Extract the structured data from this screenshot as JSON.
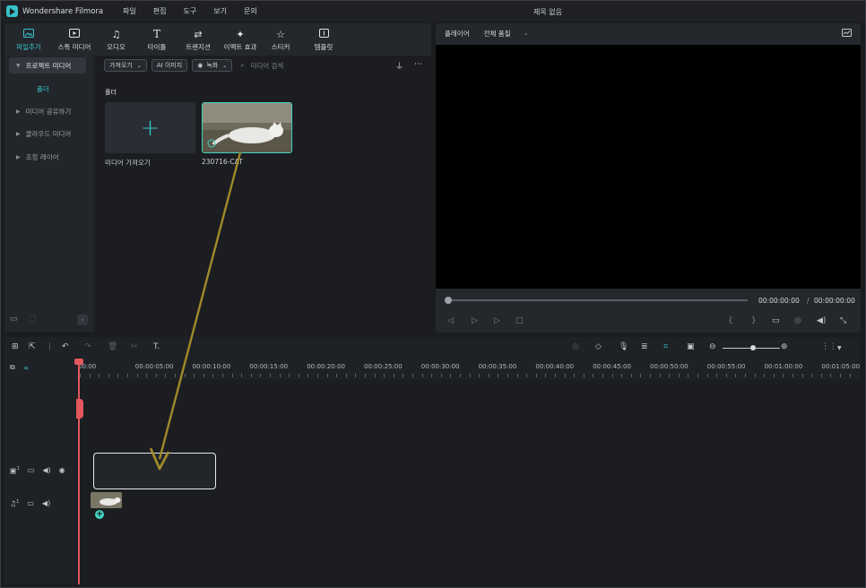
{
  "app": {
    "name": "Wondershare Filmora",
    "menu": [
      "파일",
      "편집",
      "도구",
      "보기",
      "문의"
    ],
    "document_title": "제목 없음"
  },
  "toolbar": {
    "tools": [
      {
        "label": "파일추가",
        "icon": "media-icon",
        "active": true
      },
      {
        "label": "스톡 미디어",
        "icon": "stock-media-icon",
        "active": false
      },
      {
        "label": "오디오",
        "icon": "music-note-icon",
        "active": false
      },
      {
        "label": "타이틀",
        "icon": "text-icon",
        "active": false
      },
      {
        "label": "트랜지션",
        "icon": "transition-icon",
        "active": false
      },
      {
        "label": "이펙트 효과",
        "icon": "effects-icon",
        "active": false
      },
      {
        "label": "스티커",
        "icon": "sticker-icon",
        "active": false
      },
      {
        "label": "템플릿",
        "icon": "template-icon",
        "active": false
      }
    ]
  },
  "sidebar": {
    "items": [
      {
        "label": "프로젝트 미디어",
        "active": true
      },
      {
        "label": "미디어 공유하기",
        "active": false
      },
      {
        "label": "클라우드 미디어",
        "active": false
      },
      {
        "label": "조정 레이어",
        "active": false
      }
    ],
    "sub_item": "폴더"
  },
  "filter": {
    "import_label": "가져오기",
    "ai_label": "AI 이미지",
    "record_label": "녹화",
    "search_placeholder": "미디어 검색"
  },
  "media": {
    "section_label": "폴더",
    "import_tile_label": "미디어 가져오기",
    "clip_name": "230716-CAT"
  },
  "player": {
    "label": "플레이어",
    "quality": "전체 품질",
    "current_time": "00:00:00:00",
    "separator": "/",
    "total_time": "00:00:00:00",
    "progress": 0
  },
  "timeline": {
    "ruler_labels": [
      "00:00",
      "00:00:05:00",
      "00:00:10:00",
      "00:00:15:00",
      "00:00:20:00",
      "00:00:25:00",
      "00:00:30:00",
      "00:00:35:00",
      "00:00:40:00",
      "00:00:45:00",
      "00:00:50:00",
      "00:00:55:00",
      "00:01:00:00",
      "00:01:05:00"
    ],
    "video_track_number": "1",
    "audio_track_number": "1"
  },
  "colors": {
    "accent": "#36c7cf",
    "playhead": "#e4585d",
    "arrow": "#a08a2a",
    "clip_border": "#44d3c1"
  }
}
